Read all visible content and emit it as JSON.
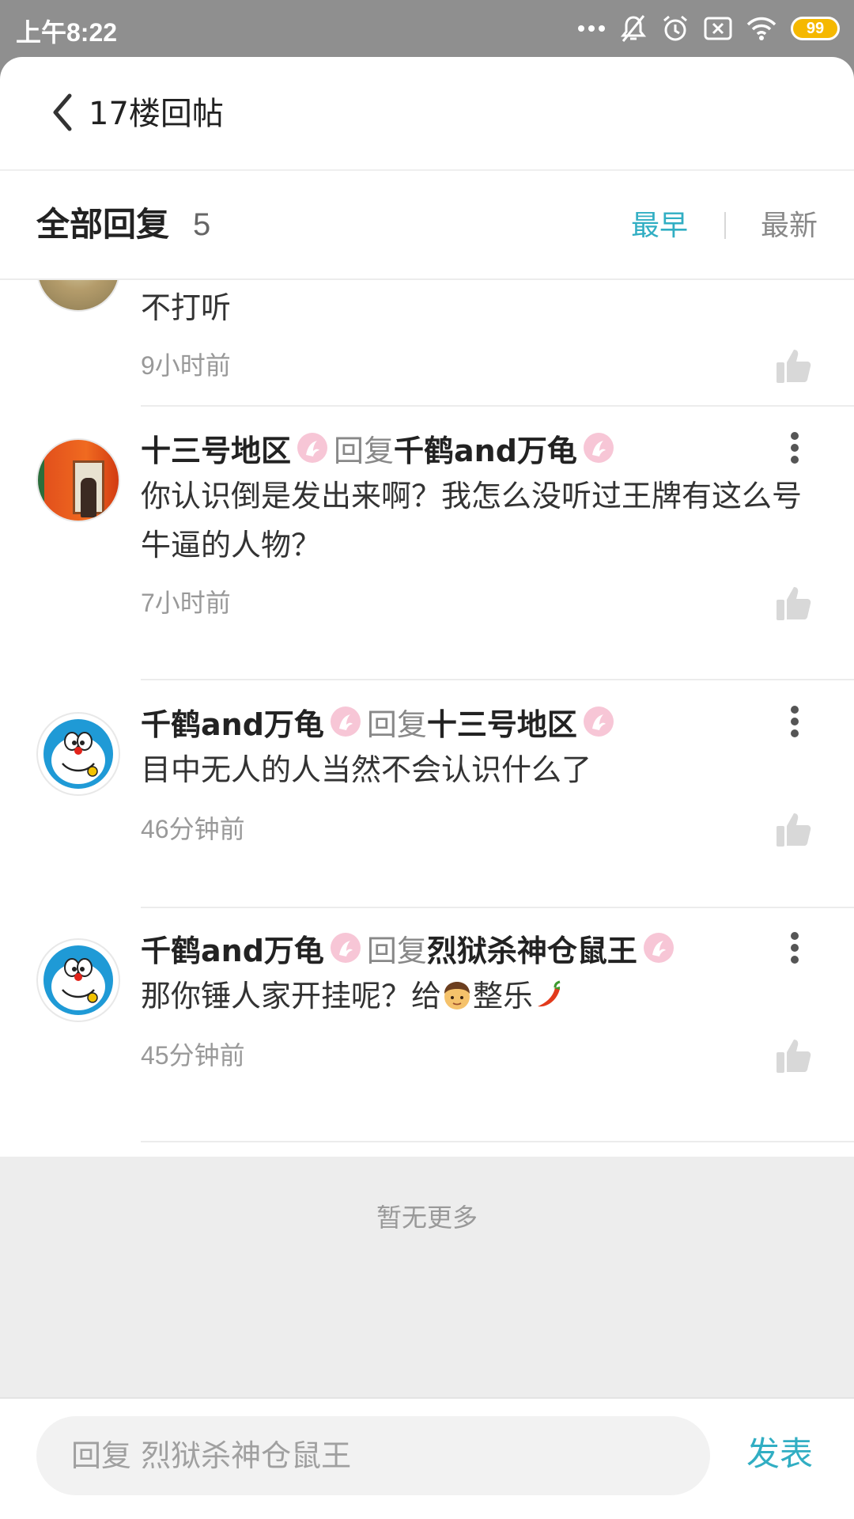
{
  "status_bar": {
    "time": "上午8:22",
    "battery": "99",
    "icons": [
      "more-dots-icon",
      "mute-bell-icon",
      "alarm-icon",
      "sim-x-icon",
      "wifi-icon",
      "battery-icon"
    ]
  },
  "header": {
    "title": "17楼回帖",
    "back_icon": "chevron-left-icon"
  },
  "reply_header": {
    "title": "全部回复",
    "count": "5",
    "sort_earliest": "最早",
    "sort_latest": "最新",
    "active_sort_color": "#31aec3"
  },
  "comments": [
    {
      "username": "",
      "text": "不打听",
      "time": "9小时前",
      "avatar": "cat-avatar"
    },
    {
      "username": "十三号地区",
      "reply_word": "回复",
      "reply_to": "千鹤and万龟",
      "text": "你认识倒是发出来啊？我怎么没听过王牌有这么号牛逼的人物？",
      "time": "7小时前",
      "avatar": "photo-avatar"
    },
    {
      "username": "千鹤and万龟",
      "reply_word": "回复",
      "reply_to": "十三号地区",
      "text": "目中无人的人当然不会认识什么了",
      "time": "46分钟前",
      "avatar": "doraemon-avatar"
    },
    {
      "username": "千鹤and万龟",
      "reply_word": "回复",
      "reply_to": "烈狱杀神仓鼠王",
      "text_before": "那你锤人家开挂呢？给",
      "text_after": "整乐",
      "emojis": [
        "boy-emoji",
        "chili-pepper-emoji"
      ],
      "time": "45分钟前",
      "avatar": "doraemon-avatar"
    }
  ],
  "footer": {
    "no_more": "暂无更多"
  },
  "composer": {
    "placeholder": "回复 烈狱杀神仓鼠王",
    "send_label": "发表"
  }
}
